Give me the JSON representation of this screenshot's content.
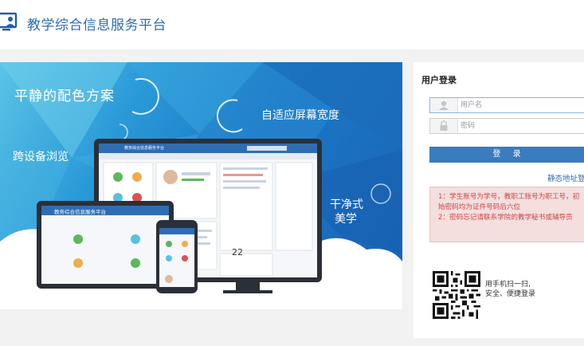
{
  "header": {
    "title": "教学综合信息服务平台",
    "logo_icon": "monitor-user-icon"
  },
  "banner": {
    "slogan_calm_colors": "平静的配色方案",
    "slogan_adaptive": "自适应屏幕宽度",
    "slogan_cross_device": "跨设备浏览",
    "slogan_clean": "干净式",
    "slogan_beauty": "美学",
    "mock_screen_title": "教务综合信息服务平台",
    "mock_tablet_title": "教务综合信息服务平台",
    "mock_date_number": "22"
  },
  "login": {
    "title": "用户登录",
    "username_placeholder": "用户名",
    "username_value": "",
    "password_placeholder": "密码",
    "password_value": "",
    "button_label": "登 录",
    "static_link": "静态地址登",
    "notice_line_1": "1：学生账号为学号，教职工账号为职工号，初始密码均为证件号码后六位",
    "notice_line_2": "2：密码忘记请联系学院的教学秘书或辅导员"
  },
  "qr": {
    "line_1": "用手机扫一扫,",
    "line_2": "安全、便捷登录"
  },
  "colors": {
    "brand_blue": "#2d6cb2",
    "button_blue": "#3a7cc0",
    "notice_red": "#d04545",
    "notice_bg": "#f4dede"
  }
}
